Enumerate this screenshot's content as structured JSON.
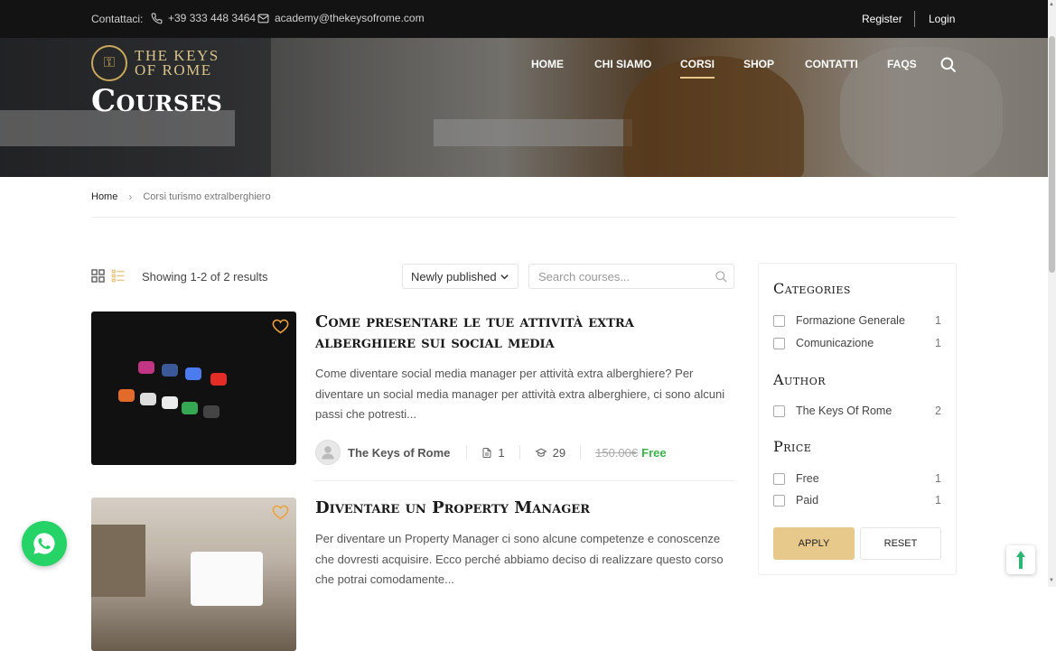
{
  "topbar": {
    "contact_label": "Contattaci:",
    "phone": "+39 333 448 3464",
    "email": "academy@thekeysofrome.com",
    "register": "Register",
    "login": "Login"
  },
  "brand": {
    "line1": "THE KEYS",
    "line2": "OF ROME"
  },
  "nav": {
    "items": [
      "HOME",
      "CHI SIAMO",
      "CORSI",
      "SHOP",
      "CONTATTI",
      "FAQS"
    ],
    "active": "CORSI"
  },
  "hero": {
    "title": "Courses"
  },
  "breadcrumb": {
    "home": "Home",
    "current": "Corsi turismo extralberghiero"
  },
  "toolbar": {
    "results": "Showing 1-2 of 2 results",
    "sort_selected": "Newly published",
    "search_placeholder": "Search courses..."
  },
  "courses": [
    {
      "title": "Come presentare le tue attività extra alberghiere sui social media",
      "excerpt": "Come diventare social media manager per attività extra alberghiere? Per diventare un social media manager per attività extra alberghiere, ci sono alcuni passi che potresti...",
      "author": "The Keys of Rome",
      "lessons": "1",
      "students": "29",
      "old_price": "150.00€",
      "price": "Free"
    },
    {
      "title": "Diventare un Property Manager",
      "excerpt": "Per diventare un Property Manager ci sono alcune competenze e conoscenze che dovresti acquisire.  Ecco perché abbiamo deciso di realizzare questo corso che potrai comodamente..."
    }
  ],
  "filters": {
    "categories_title": "Categories",
    "categories": [
      {
        "label": "Formazione Generale",
        "count": "1"
      },
      {
        "label": "Comunicazione",
        "count": "1"
      }
    ],
    "author_title": "Author",
    "authors": [
      {
        "label": "The Keys Of Rome",
        "count": "2"
      }
    ],
    "price_title": "Price",
    "prices": [
      {
        "label": "Free",
        "count": "1"
      },
      {
        "label": "Paid",
        "count": "1"
      }
    ],
    "apply": "APPLY",
    "reset": "RESET"
  },
  "colors": {
    "accent": "#e8c98c",
    "free": "#3ab54a",
    "topbar": "#131313",
    "whatsapp": "#25d366"
  }
}
